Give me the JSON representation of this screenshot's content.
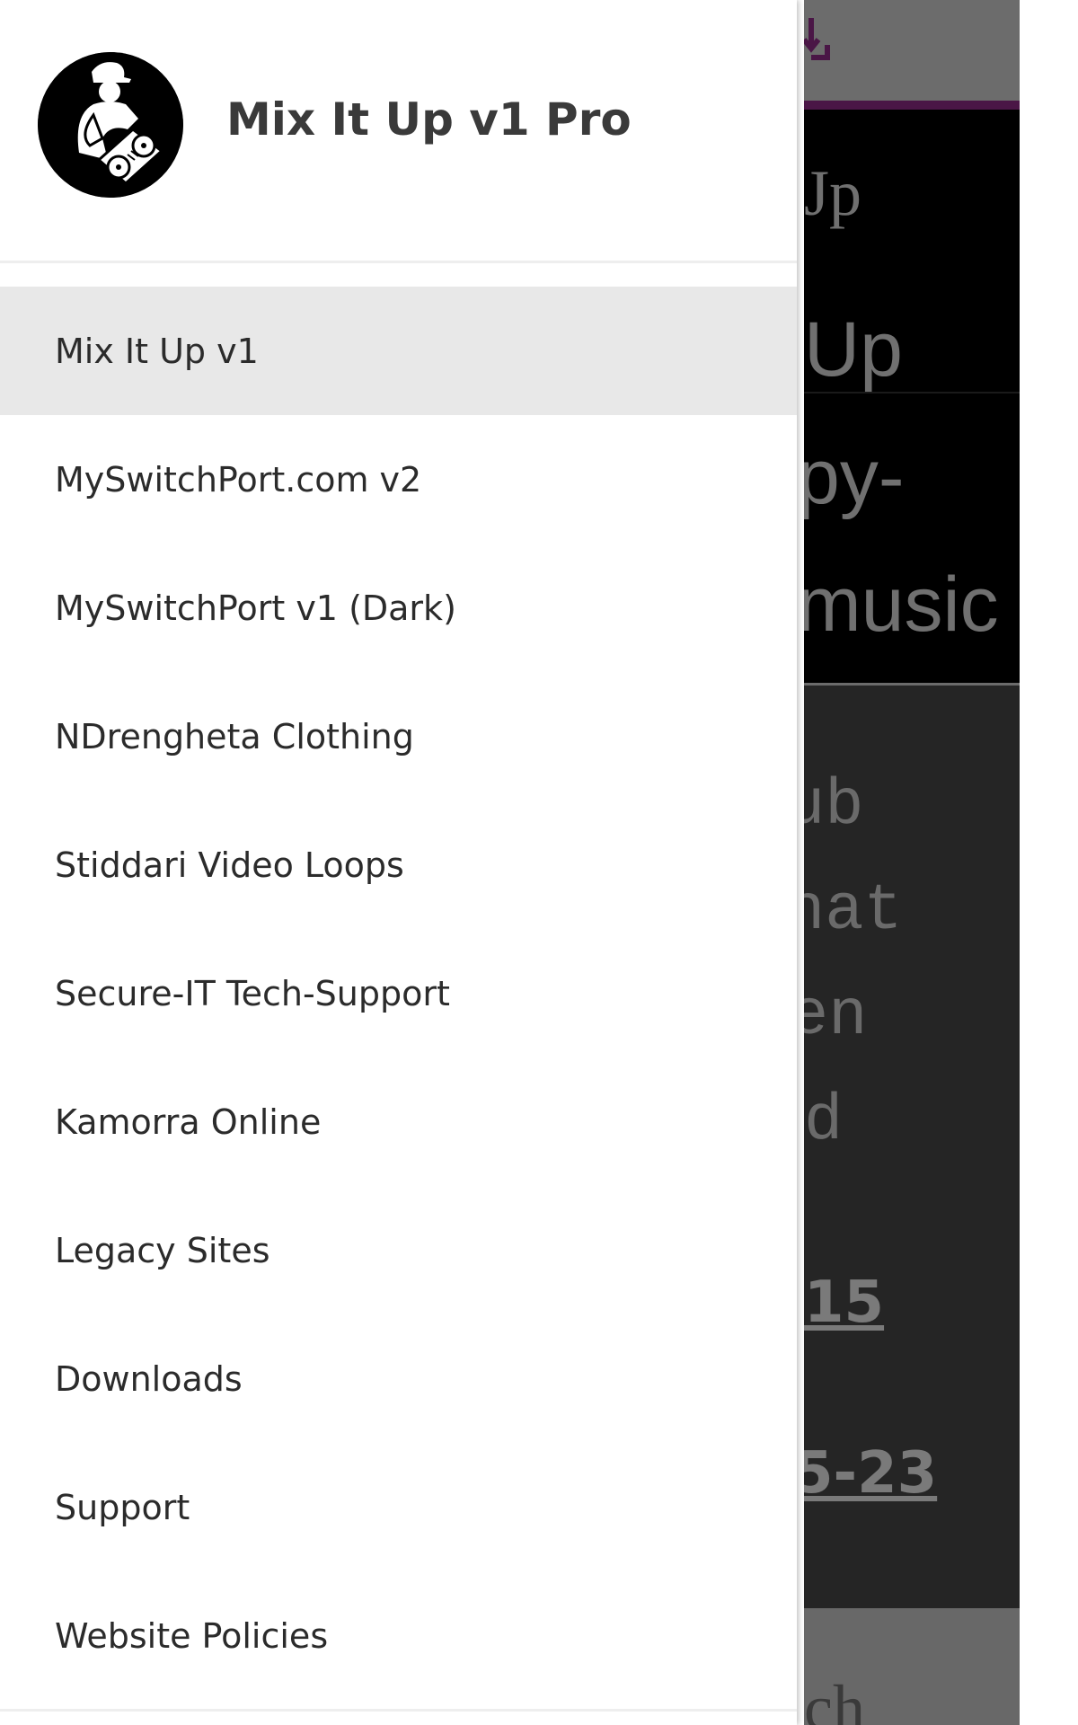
{
  "app": {
    "site_title": "Mix It Up v1 Pro",
    "logo_icon": "dj-turntables-logo"
  },
  "menu": {
    "items": [
      {
        "label": "Mix It Up v1",
        "active": true
      },
      {
        "label": "MySwitchPort.com v2",
        "active": false
      },
      {
        "label": "MySwitchPort v1 (Dark)",
        "active": false
      },
      {
        "label": "NDrengheta Clothing",
        "active": false
      },
      {
        "label": "Stiddari Video Loops",
        "active": false
      },
      {
        "label": "Secure-IT Tech-Support",
        "active": false
      },
      {
        "label": "Kamorra Online",
        "active": false
      },
      {
        "label": "Legacy Sites",
        "active": false
      },
      {
        "label": "Downloads",
        "active": false
      },
      {
        "label": "Support",
        "active": false
      },
      {
        "label": "Website Policies",
        "active": false
      }
    ]
  },
  "background": {
    "header_fragment": "Jp",
    "hero_lines": [
      "Up",
      "py-",
      "music"
    ],
    "body_lines": [
      "ub",
      "hat",
      "en",
      "d"
    ],
    "link_1": "15",
    "link_2": "5-23",
    "footer_fragment": "ch",
    "icon": "download-icon"
  },
  "colors": {
    "accent": "#4a1646",
    "active_item_bg": "#e8e8e8",
    "menu_text": "#2b2b2b",
    "title_text": "#3a3a3a"
  }
}
